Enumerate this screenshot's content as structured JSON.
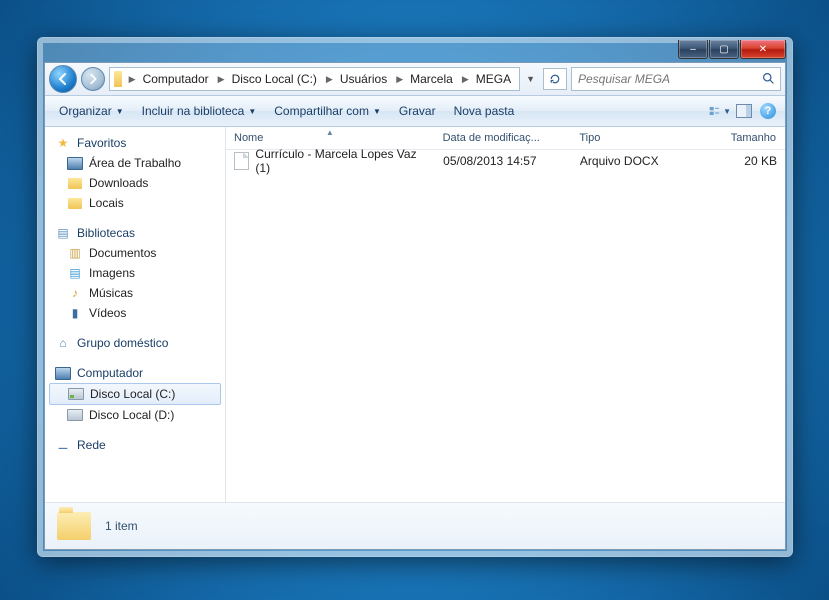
{
  "window": {
    "controls": {
      "min": "–",
      "max": "▢",
      "close": "✕"
    }
  },
  "nav": {
    "breadcrumb": [
      "Computador",
      "Disco Local (C:)",
      "Usuários",
      "Marcela",
      "MEGA"
    ],
    "search_placeholder": "Pesquisar MEGA"
  },
  "toolbar": {
    "organize": "Organizar",
    "include": "Incluir na biblioteca",
    "share": "Compartilhar com",
    "burn": "Gravar",
    "newfolder": "Nova pasta"
  },
  "columns": {
    "name": "Nome",
    "date": "Data de modificaç...",
    "type": "Tipo",
    "size": "Tamanho"
  },
  "files": [
    {
      "name": "Currículo - Marcela Lopes Vaz (1)",
      "date": "05/08/2013 14:57",
      "type": "Arquivo DOCX",
      "size": "20 KB"
    }
  ],
  "sidebar": {
    "favorites": {
      "label": "Favoritos",
      "items": [
        "Área de Trabalho",
        "Downloads",
        "Locais"
      ]
    },
    "libraries": {
      "label": "Bibliotecas",
      "items": [
        "Documentos",
        "Imagens",
        "Músicas",
        "Vídeos"
      ]
    },
    "homegroup": {
      "label": "Grupo doméstico"
    },
    "computer": {
      "label": "Computador",
      "items": [
        "Disco Local (C:)",
        "Disco Local (D:)"
      ]
    },
    "network": {
      "label": "Rede"
    }
  },
  "status": {
    "count": "1 item"
  }
}
